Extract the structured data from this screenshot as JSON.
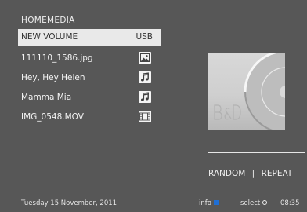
{
  "header": {
    "title": "HOMEMEDIA"
  },
  "list": {
    "selected": {
      "label": "NEW VOLUME",
      "right_text": "USB"
    },
    "items": [
      {
        "label": "111110_1586.jpg",
        "icon": "image-icon"
      },
      {
        "label": "Hey, Hey Helen",
        "icon": "music-note-icon"
      },
      {
        "label": "Mamma Mia",
        "icon": "music-note-icon"
      },
      {
        "label": "IMG_0548.MOV",
        "icon": "film-icon"
      }
    ]
  },
  "cover": {
    "logo": "B&O",
    "icon": "cd-disc-icon"
  },
  "playback": {
    "random_label": "RANDOM",
    "separator": "|",
    "repeat_label": "REPEAT"
  },
  "footer": {
    "date": "Tuesday 15 November, 2011",
    "info_label": "info",
    "select_label": "select",
    "time": "08:35"
  },
  "colors": {
    "background": "#575757",
    "selected_row": "#e9e9e9",
    "info_blue": "#1f6fd6"
  }
}
